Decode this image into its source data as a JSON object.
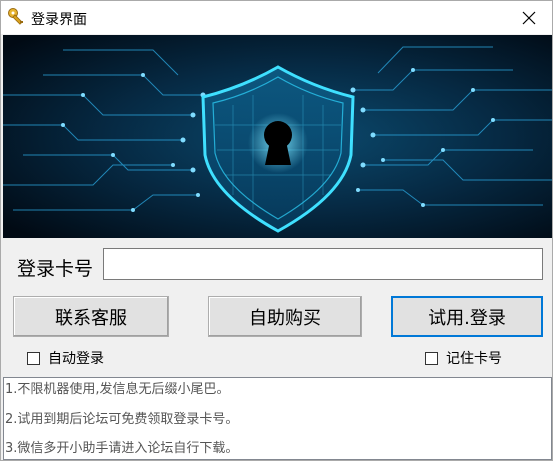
{
  "window": {
    "title": "登录界面"
  },
  "form": {
    "card_label": "登录卡号",
    "card_value": "",
    "service_button": "联系客服",
    "buy_button": "自助购买",
    "login_button": "试用.登录",
    "auto_login_label": "自动登录",
    "auto_login_checked": false,
    "remember_card_label": "记住卡号",
    "remember_card_checked": false
  },
  "notice": {
    "lines": [
      "1.不限机器使用,发信息无后缀小尾巴。",
      "2.试用到期后论坛可免费领取登录卡号。",
      "3.微信多开小助手请进入论坛自行下载。"
    ]
  },
  "icons": {
    "title": "keys-icon",
    "close": "close-icon",
    "banner": "shield-keyhole-icon"
  },
  "colors": {
    "banner_bg": "#02101c",
    "shield_glow": "#2fd6ff",
    "focus_border": "#0078d7"
  }
}
